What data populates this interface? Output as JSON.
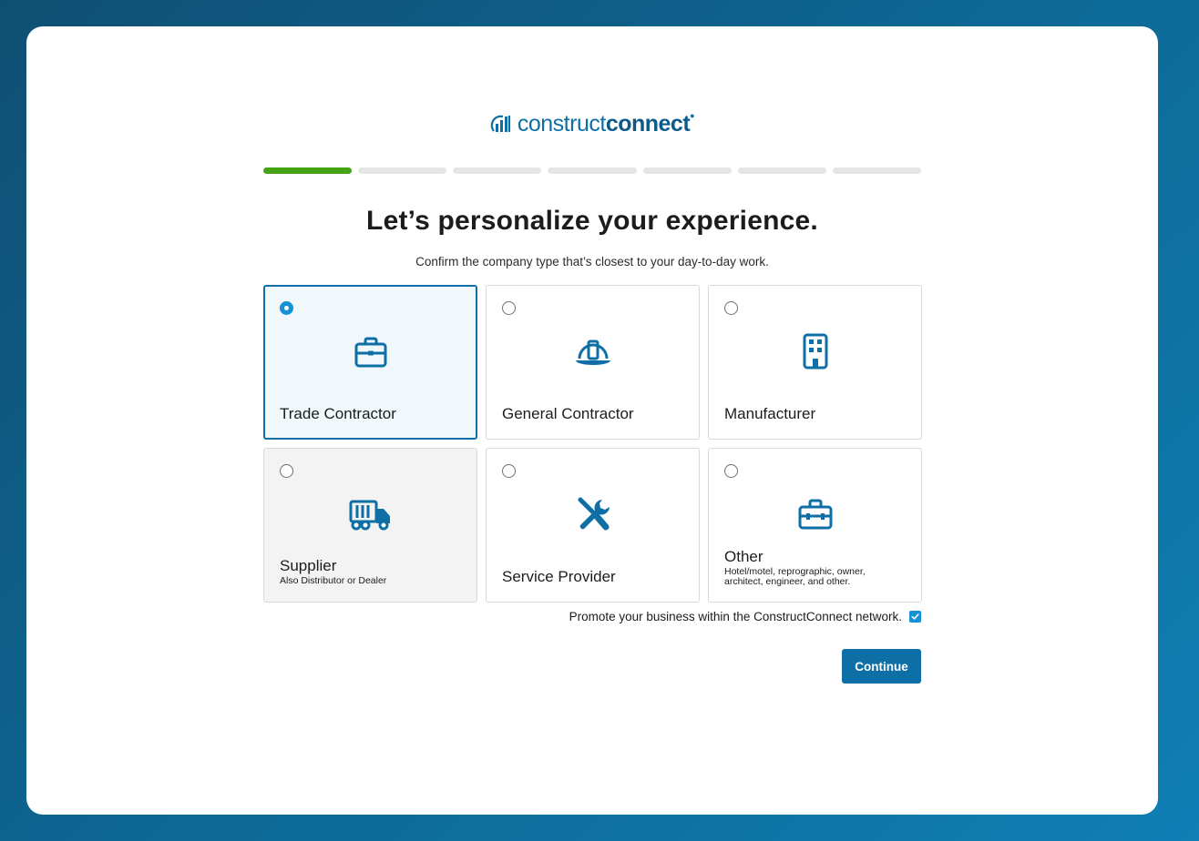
{
  "brand": {
    "logo_light": "construct",
    "logo_bold": "connect",
    "logo_mark": "registered-dot",
    "accent": "#0e6fa6",
    "progress_color": "#43a315"
  },
  "progress": {
    "total_steps": 7,
    "completed_steps": 1
  },
  "header": {
    "title": "Let’s personalize your experience.",
    "subtitle": "Confirm the company type that’s closest to your day-to-day work."
  },
  "options": [
    {
      "label": "Trade Contractor",
      "sub": "",
      "icon": "briefcase-icon",
      "selected": true
    },
    {
      "label": "General Contractor",
      "sub": "",
      "icon": "hard-hat-icon",
      "selected": false
    },
    {
      "label": "Manufacturer",
      "sub": "",
      "icon": "building-icon",
      "selected": false
    },
    {
      "label": "Supplier",
      "sub": "Also Distributor or Dealer",
      "icon": "truck-icon",
      "selected": false
    },
    {
      "label": "Service Provider",
      "sub": "",
      "icon": "tools-icon",
      "selected": false
    },
    {
      "label": "Other",
      "sub": "Hotel/motel, reprographic, owner, architect, engineer, and other.",
      "icon": "toolbox-icon",
      "selected": false
    }
  ],
  "promote": {
    "label": "Promote your business within the ConstructConnect network.",
    "checked": true
  },
  "actions": {
    "continue_label": "Continue"
  }
}
